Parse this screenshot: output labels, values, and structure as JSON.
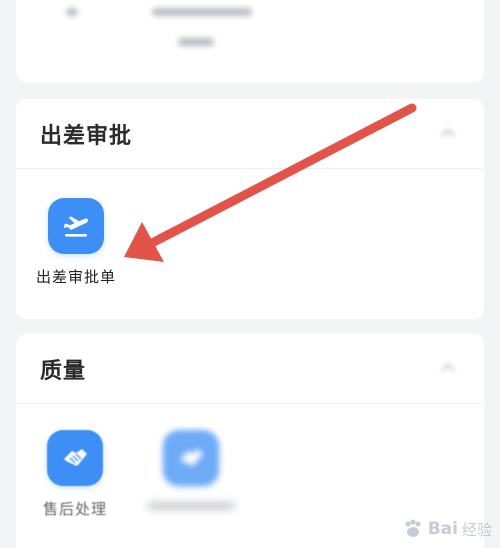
{
  "colors": {
    "accent": "#3d8ff5",
    "arrow": "#e2544a",
    "background": "#f3f4f6",
    "card": "#ffffff"
  },
  "top_section": {
    "blurred": true
  },
  "business_trip_section": {
    "title": "出差审批",
    "collapse_icon": "chevron-up-icon",
    "apps": [
      {
        "label": "出差审批单",
        "icon": "airplane-takeoff-icon"
      }
    ]
  },
  "quality_section": {
    "title": "质量",
    "collapse_icon": "chevron-up-icon",
    "apps": [
      {
        "label": "售后处理",
        "icon": "handshake-icon"
      },
      {
        "label": "",
        "icon": "handshake-icon",
        "blurred": true
      }
    ]
  },
  "annotation": {
    "type": "arrow",
    "color": "#e2544a",
    "points_to": "出差审批单"
  },
  "watermark": {
    "text": "Bai",
    "suffix": "经验",
    "logo": "baidu-paw-logo"
  }
}
